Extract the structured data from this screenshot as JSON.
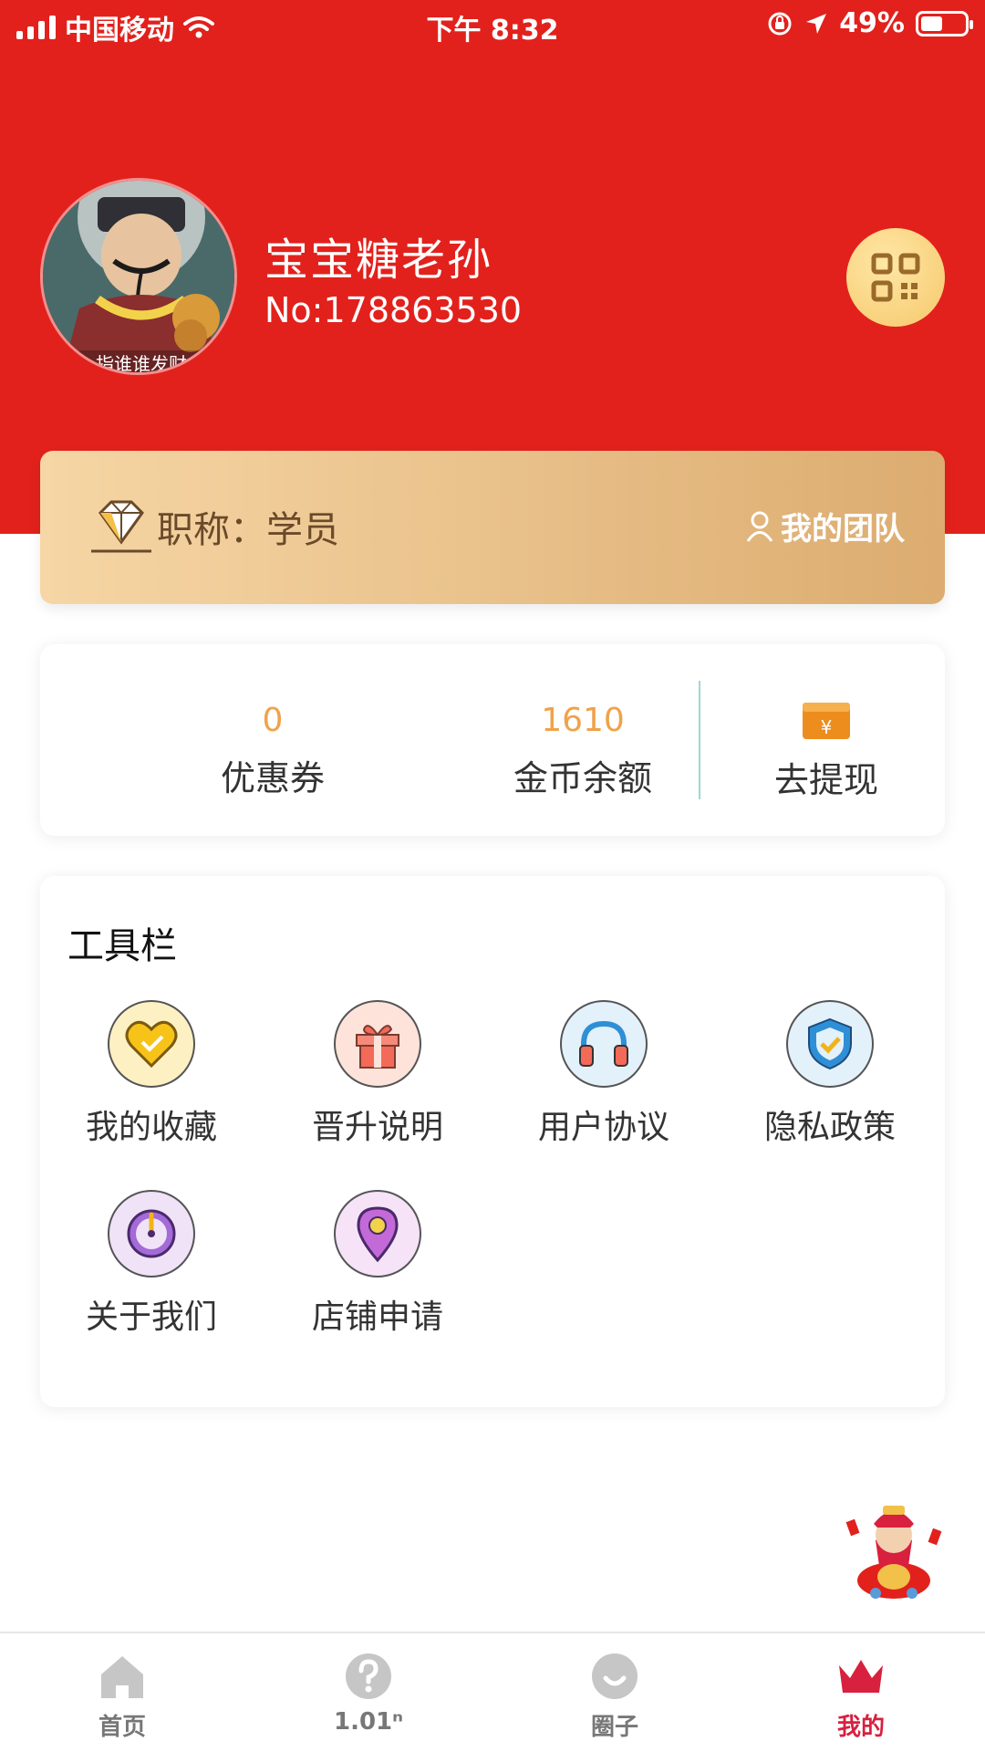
{
  "status_bar": {
    "carrier": "中国移动",
    "time": "下午 8:32",
    "battery": "49%",
    "battery_level": 0.49
  },
  "profile": {
    "name": "宝宝糖老孙",
    "number": "No:178863530",
    "avatar_caption": "指谁谁发财"
  },
  "rank_card": {
    "label": "职称：学员",
    "team_label": "我的团队"
  },
  "balance": {
    "coupons_value": "0",
    "coupons_label": "优惠券",
    "coins_value": "1610",
    "coins_label": "金币余额",
    "withdraw_label": "去提现",
    "withdraw_icon_text": "¥"
  },
  "tools": {
    "title": "工具栏",
    "items": [
      {
        "label": "我的收藏",
        "icon": "heart-icon"
      },
      {
        "label": "晋升说明",
        "icon": "gift-icon"
      },
      {
        "label": "用户协议",
        "icon": "headphones-icon"
      },
      {
        "label": "隐私政策",
        "icon": "shield-icon"
      },
      {
        "label": "关于我们",
        "icon": "gauge-icon"
      },
      {
        "label": "店铺申请",
        "icon": "location-pin-icon"
      }
    ]
  },
  "tabbar": {
    "items": [
      {
        "label": "首页",
        "icon": "home-icon"
      },
      {
        "label": "1.01ⁿ",
        "icon": "question-icon"
      },
      {
        "label": "圈子",
        "icon": "smile-icon"
      },
      {
        "label": "我的",
        "icon": "crown-icon"
      }
    ],
    "active": "我的"
  },
  "colors": {
    "brand_red": "#e2211c",
    "gold": "#e1b172",
    "coin_orange": "#f0a24a",
    "tab_active": "#d8203f"
  }
}
